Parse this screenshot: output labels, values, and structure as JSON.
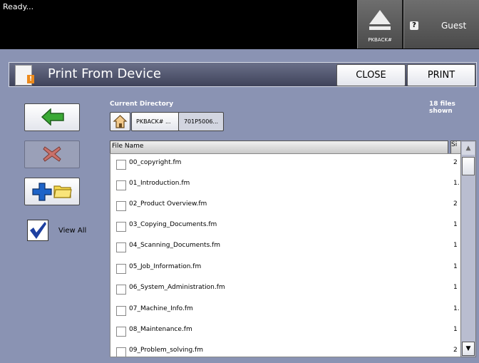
{
  "status": {
    "text": "Ready..."
  },
  "header_buttons": {
    "eject_label": "PKBACK#",
    "guest_label": "Guest"
  },
  "title": {
    "text": "Print From Device",
    "close_label": "CLOSE",
    "print_label": "PRINT"
  },
  "left_panel": {
    "view_all_label": "View All",
    "view_all_checked": true
  },
  "directory": {
    "label": "Current Directory",
    "files_shown": "18 files shown",
    "breadcrumbs": [
      "PKBACK# ...",
      "701P5006..."
    ]
  },
  "file_list": {
    "header_name": "File Name",
    "header_size": "Si",
    "rows": [
      {
        "name": "00_copyright.fm",
        "size": "2"
      },
      {
        "name": "01_Introduction.fm",
        "size": "1."
      },
      {
        "name": "02_Product Overview.fm",
        "size": "2"
      },
      {
        "name": "03_Copying_Documents.fm",
        "size": "1"
      },
      {
        "name": "04_Scanning_Documents.fm",
        "size": "1"
      },
      {
        "name": "05_Job_Information.fm",
        "size": "1"
      },
      {
        "name": "06_System_Administration.fm",
        "size": "1"
      },
      {
        "name": "07_Machine_Info.fm",
        "size": "1."
      },
      {
        "name": "08_Maintenance.fm",
        "size": "1"
      },
      {
        "name": "09_Problem_solving.fm",
        "size": "2"
      }
    ]
  },
  "colors": {
    "background": "#8a93b3",
    "title_bar": "#4f5470",
    "accent_green": "#3aa935",
    "accent_red": "#c0392b",
    "accent_blue": "#1d63c8"
  }
}
